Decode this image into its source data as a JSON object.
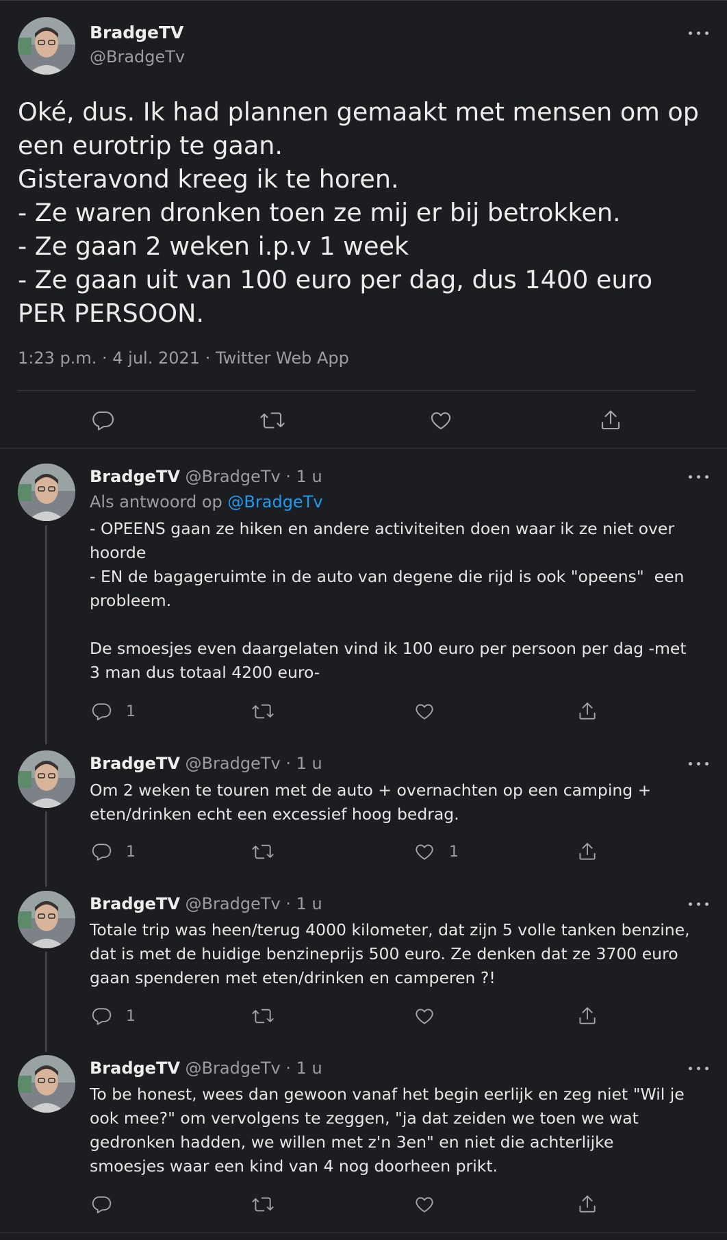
{
  "main_tweet": {
    "display_name": "BradgeTV",
    "handle": "@BradgeTv",
    "text": "Oké, dus. Ik had plannen gemaakt met mensen om op een eurotrip te gaan.\nGisteravond kreeg ik te horen.\n- Ze waren dronken toen ze mij er bij betrokken.\n- Ze gaan 2 weken i.p.v 1 week\n- Ze gaan uit van 100 euro per dag, dus 1400 euro PER PERSOON.",
    "meta": "1:23 p.m. · 4 jul. 2021 · Twitter Web App"
  },
  "replies": [
    {
      "display_name": "BradgeTV",
      "handle_time": "@BradgeTv · 1 u",
      "reply_to_label": "Als antwoord op",
      "reply_to_handle": "@BradgeTv",
      "text": "- OPEENS gaan ze hiken en andere activiteiten doen waar ik ze niet over hoorde\n- EN de bagageruimte in de auto van degene die rijd is ook \"opeens\"  een probleem.\n\nDe smoesjes even daargelaten vind ik 100 euro per persoon per dag -met 3 man dus totaal 4200 euro-",
      "reply_count": "1",
      "like_count": ""
    },
    {
      "display_name": "BradgeTV",
      "handle_time": "@BradgeTv · 1 u",
      "text": "Om 2 weken te touren met de auto + overnachten op een camping + eten/drinken echt een excessief hoog bedrag.",
      "reply_count": "1",
      "like_count": "1"
    },
    {
      "display_name": "BradgeTV",
      "handle_time": "@BradgeTv · 1 u",
      "text": "Totale trip was heen/terug 4000 kilometer, dat zijn 5 volle tanken benzine, dat is met de huidige benzineprijs 500 euro. Ze denken dat ze 3700 euro gaan spenderen met eten/drinken en camperen ?!",
      "reply_count": "1",
      "like_count": ""
    },
    {
      "display_name": "BradgeTV",
      "handle_time": "@BradgeTv · 1 u",
      "text": "To be honest, wees dan gewoon vanaf het begin eerlijk en zeg niet \"Wil je ook mee?\" om vervolgens te zeggen, \"ja dat zeiden we toen we wat gedronken hadden, we willen met z'n 3en\" en niet die achterlijke smoesjes waar een kind van 4 nog doorheen prikt.",
      "reply_count": "",
      "like_count": ""
    }
  ],
  "colors": {
    "background": "#1c1d20",
    "text": "#e6e6e6",
    "secondary": "#9b9da1",
    "link": "#1d9bf0"
  },
  "icons": [
    "reply-icon",
    "retweet-icon",
    "like-icon",
    "share-icon",
    "more-icon"
  ]
}
